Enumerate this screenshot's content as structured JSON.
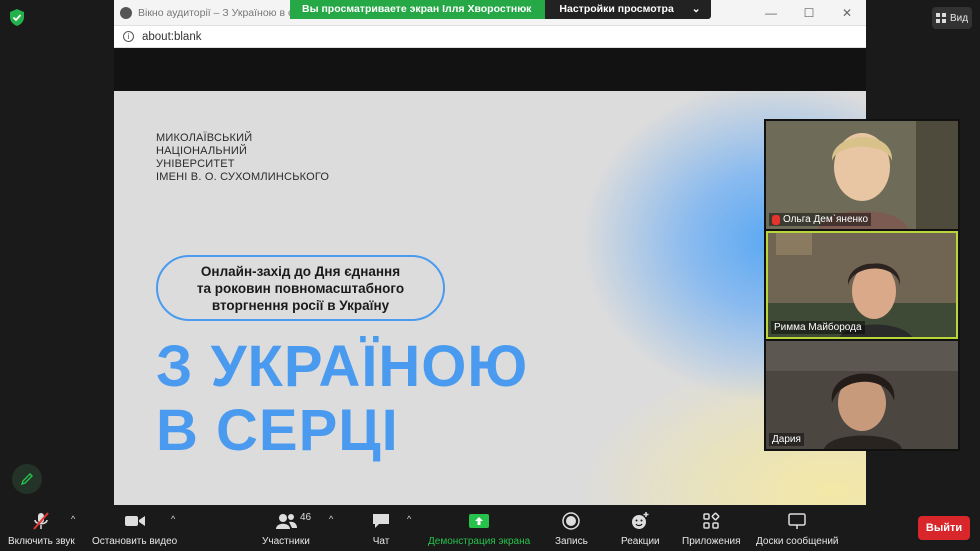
{
  "banner": {
    "sharing_text": "Вы просматриваете экран Ілля Хворостнюк",
    "settings_label": "Настройки просмотра",
    "settings_icon": "chevron-down-icon"
  },
  "view_button": {
    "label": "Вид",
    "icon": "grid-icon"
  },
  "browser": {
    "title": "Вікно аудиторії – З Україною в сер",
    "url": "about:blank",
    "controls": [
      "—",
      "☐",
      "✕"
    ]
  },
  "slide": {
    "university": [
      "МИКОЛАЇВСЬКИЙ",
      "НАЦІОНАЛЬНИЙ",
      "УНІВЕРСИТЕТ",
      "ІМЕНІ В. О. СУХОМЛИНСЬКОГО"
    ],
    "event": [
      "Онлайн-захід до Дня єднання",
      "та роковин повномасштабного",
      "вторгнення росії в Україну"
    ],
    "headline": [
      "З УКРАЇНОЮ",
      "В СЕРЦІ"
    ],
    "colors": {
      "accent": "#4a9bf0",
      "background": "#dcdcdc"
    }
  },
  "participants": [
    {
      "name": "Ольга Дем`яненко",
      "muted": true,
      "active": false
    },
    {
      "name": "Римма Майборода",
      "muted": false,
      "active": true
    },
    {
      "name": "Дария",
      "muted": false,
      "active": false
    }
  ],
  "toolbar": {
    "unmute": {
      "label": "Включить звук",
      "icon": "microphone-muted-icon"
    },
    "video": {
      "label": "Остановить видео",
      "icon": "video-camera-icon"
    },
    "participants": {
      "label": "Участники",
      "count": "46",
      "icon": "participants-icon"
    },
    "chat": {
      "label": "Чат",
      "icon": "chat-icon"
    },
    "share": {
      "label": "Демонстрация экрана",
      "icon": "share-screen-icon",
      "color": "#27c24c"
    },
    "record": {
      "label": "Запись",
      "icon": "record-icon"
    },
    "reactions": {
      "label": "Реакции",
      "icon": "emoji-icon"
    },
    "apps": {
      "label": "Приложения",
      "icon": "apps-icon"
    },
    "whiteboards": {
      "label": "Доски сообщений",
      "icon": "whiteboard-icon"
    },
    "exit": {
      "label": "Выйти",
      "color": "#d8262b"
    }
  }
}
